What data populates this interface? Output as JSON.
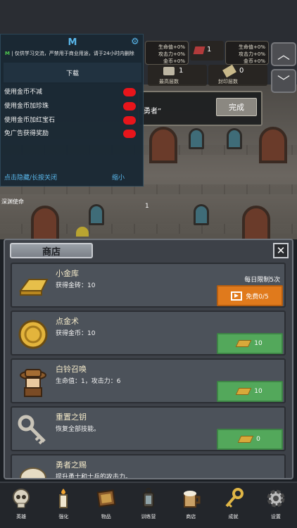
{
  "top_stats": {
    "left": {
      "hp": "生命值+0%",
      "atk": "攻击力+0%",
      "gold": "金币+0%"
    },
    "right": {
      "hp": "生命值+0%",
      "atk": "攻击力+0%",
      "gold": "金币+0%"
    },
    "gem_value": "1",
    "highest_floor_label": "最高层数",
    "highest_floor_value": "1",
    "seal_floor_label": "封印层数",
    "seal_floor_value": "0"
  },
  "quest": {
    "text": "勇者”",
    "done_label": "完成"
  },
  "mod_menu": {
    "title": "M",
    "notice_tag": "M",
    "notice": "| 仅供学习交流，严禁用于商业用途，请于24小时内删除",
    "download_label": "下载",
    "options": [
      {
        "label": "使用金币不减",
        "enabled": true
      },
      {
        "label": "使用金币加珍珠",
        "enabled": true
      },
      {
        "label": "使用金币加红宝石",
        "enabled": true
      },
      {
        "label": "免广告获得奖励",
        "enabled": true
      }
    ],
    "hide_label": "点击隐藏/长按关闭",
    "minimize_label": "缩小"
  },
  "scene": {
    "deep_label": "深渊使命",
    "level": "1"
  },
  "shop": {
    "title": "商店",
    "close": "✕",
    "items": [
      {
        "name": "小金库",
        "desc": "获得金砖：10",
        "limit": "每日限制5次",
        "button": "免费0/5",
        "button_type": "video"
      },
      {
        "name": "点金术",
        "desc": "获得金币：10",
        "button": "10",
        "button_type": "gold"
      },
      {
        "name": "白铃召唤",
        "desc": "生命值：1，攻击力：6",
        "button": "10",
        "button_type": "gold"
      },
      {
        "name": "重置之钥",
        "desc": "恢复全部技能。",
        "button": "0",
        "button_type": "gold"
      },
      {
        "name": "勇者之赐",
        "desc": "提升勇士和士兵的攻击力。",
        "button": "",
        "button_type": "gold"
      }
    ]
  },
  "nav": [
    {
      "label": "英雄",
      "icon": "skull-icon"
    },
    {
      "label": "强化",
      "icon": "candle-icon"
    },
    {
      "label": "物品",
      "icon": "book-icon"
    },
    {
      "label": "训练营",
      "icon": "lantern-icon"
    },
    {
      "label": "商店",
      "icon": "mug-icon"
    },
    {
      "label": "成就",
      "icon": "key-icon"
    },
    {
      "label": "设置",
      "icon": "gear-icon"
    }
  ]
}
